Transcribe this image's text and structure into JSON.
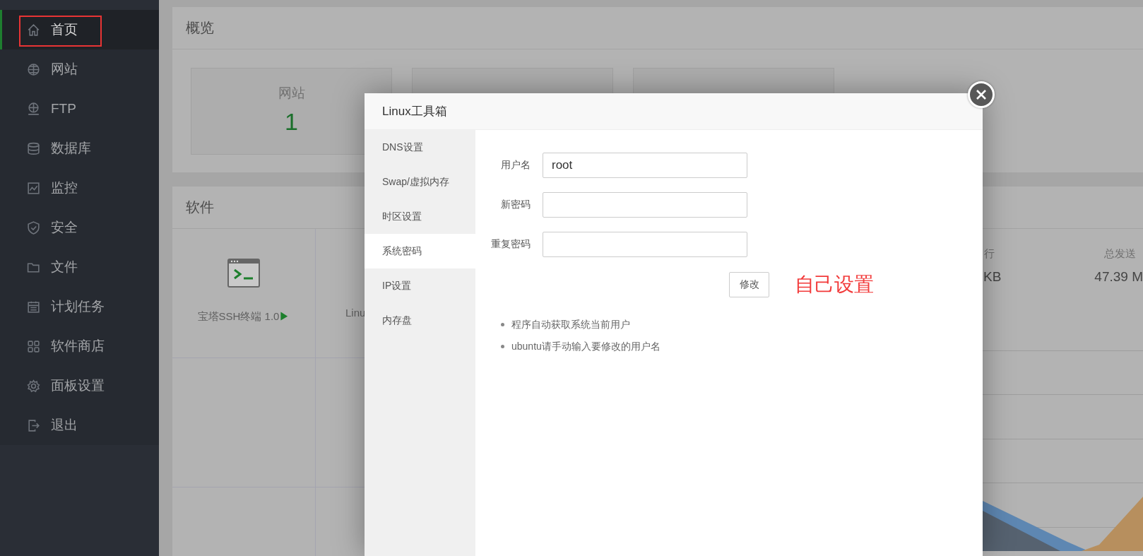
{
  "sidebar": {
    "items": [
      {
        "label": "首页",
        "selected": true,
        "annotated": true
      },
      {
        "label": "网站",
        "selected": false,
        "annotated": false
      },
      {
        "label": "FTP",
        "selected": false,
        "annotated": false
      },
      {
        "label": "数据库",
        "selected": false,
        "annotated": false
      },
      {
        "label": "监控",
        "selected": false,
        "annotated": false
      },
      {
        "label": "安全",
        "selected": false,
        "annotated": false
      },
      {
        "label": "文件",
        "selected": false,
        "annotated": false
      },
      {
        "label": "计划任务",
        "selected": false,
        "annotated": false
      },
      {
        "label": "软件商店",
        "selected": false,
        "annotated": false
      },
      {
        "label": "面板设置",
        "selected": false,
        "annotated": false
      },
      {
        "label": "退出",
        "selected": false,
        "annotated": false
      }
    ]
  },
  "overview": {
    "title": "概览",
    "cards": [
      {
        "kind": "stat",
        "label": "网站",
        "value": "1"
      },
      {
        "kind": "blank"
      },
      {
        "kind": "blank"
      }
    ]
  },
  "software": {
    "title": "软件",
    "tiles": [
      {
        "kind": "terminal",
        "label": "宝塔SSH终端 1.0",
        "marker": "▶"
      },
      {
        "kind": "text",
        "label": "Linu"
      }
    ]
  },
  "traffic": {
    "columns": [
      {
        "label": "行",
        "value": "KB"
      },
      {
        "label": "总发送",
        "value": "47.39 M"
      }
    ]
  },
  "dialog": {
    "title": "Linux工具箱",
    "tabs": [
      {
        "label": "DNS设置",
        "selected": false
      },
      {
        "label": "Swap/虚拟内存",
        "selected": false
      },
      {
        "label": "时区设置",
        "selected": false
      },
      {
        "label": "系统密码",
        "selected": true
      },
      {
        "label": "IP设置",
        "selected": false
      },
      {
        "label": "内存盘",
        "selected": false
      }
    ],
    "fields": [
      {
        "label": "用户名",
        "value": "root"
      },
      {
        "label": "新密码"
      },
      {
        "label": "重复密码"
      }
    ],
    "submit": "修改",
    "annotation": "自己设置",
    "notes": [
      "程序自动获取系统当前用户",
      "ubuntu请手动输入要修改的用户名"
    ]
  }
}
